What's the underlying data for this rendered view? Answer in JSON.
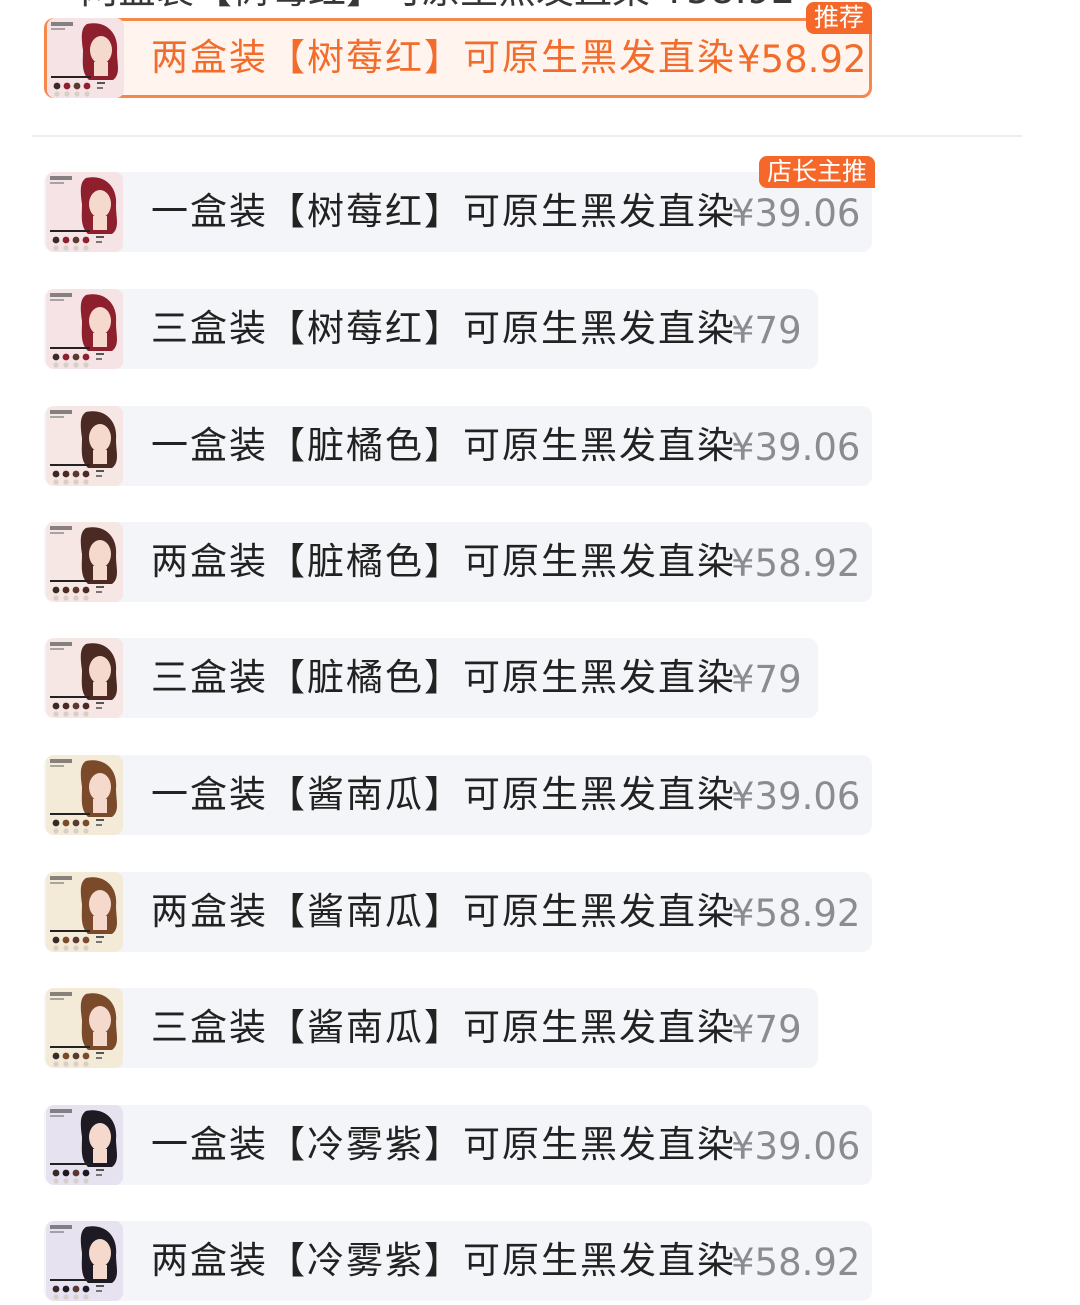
{
  "top_partial_text": "两盒装【树莓红】可原生黑发直染 ¥58.92",
  "selected_sku": {
    "label": "两盒装【树莓红】可原生黑发直染",
    "price": "¥58.92",
    "badge": "推荐"
  },
  "skus": [
    {
      "label": "一盒装【树莓红】可原生黑发直染",
      "price": "¥39.06",
      "badge": "店长主推",
      "color": "raspberry",
      "hair": "#8e1f2c",
      "bg": "#f6e3e6"
    },
    {
      "label": "三盒装【树莓红】可原生黑发直染",
      "price": "¥79",
      "badge": "",
      "color": "raspberry",
      "hair": "#8e1f2c",
      "bg": "#f6e3e6"
    },
    {
      "label": "一盒装【脏橘色】可原生黑发直染",
      "price": "¥39.06",
      "badge": "",
      "color": "dirty-orange",
      "hair": "#4a2a22",
      "bg": "#f6e6e4"
    },
    {
      "label": "两盒装【脏橘色】可原生黑发直染",
      "price": "¥58.92",
      "badge": "",
      "color": "dirty-orange",
      "hair": "#4a2a22",
      "bg": "#f6e6e4"
    },
    {
      "label": "三盒装【脏橘色】可原生黑发直染",
      "price": "¥79",
      "badge": "",
      "color": "dirty-orange",
      "hair": "#4a2a22",
      "bg": "#f6e6e4"
    },
    {
      "label": "一盒装【酱南瓜】可原生黑发直染",
      "price": "¥39.06",
      "badge": "",
      "color": "sauce-pumpkin",
      "hair": "#7a4a2a",
      "bg": "#f3ead7"
    },
    {
      "label": "两盒装【酱南瓜】可原生黑发直染",
      "price": "¥58.92",
      "badge": "",
      "color": "sauce-pumpkin",
      "hair": "#7a4a2a",
      "bg": "#f3ead7"
    },
    {
      "label": "三盒装【酱南瓜】可原生黑发直染",
      "price": "¥79",
      "badge": "",
      "color": "sauce-pumpkin",
      "hair": "#7a4a2a",
      "bg": "#f3ead7"
    },
    {
      "label": "一盒装【冷雾紫】可原生黑发直染",
      "price": "¥39.06",
      "badge": "",
      "color": "cold-mist-purple",
      "hair": "#1e1a24",
      "bg": "#e6e2f0"
    },
    {
      "label": "两盒装【冷雾紫】可原生黑发直染",
      "price": "¥58.92",
      "badge": "",
      "color": "cold-mist-purple",
      "hair": "#1e1a24",
      "bg": "#e6e2f0"
    }
  ],
  "colors": {
    "accent": "#f26d2b",
    "badge_bg": "#f5682a",
    "item_bg": "#f4f5f8",
    "price_gray": "#8a8c92"
  }
}
